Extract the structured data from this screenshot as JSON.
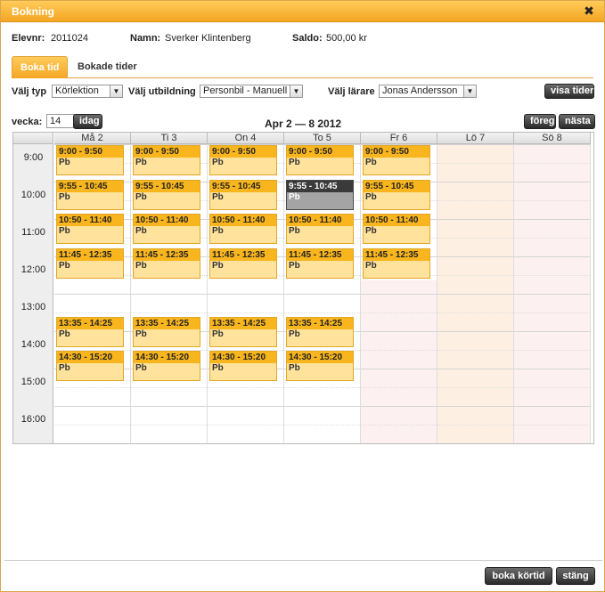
{
  "window": {
    "title": "Bokning"
  },
  "info": {
    "elevnr_label": "Elevnr:",
    "elevnr_value": "2011024",
    "namn_label": "Namn:",
    "namn_value": "Sverker Klintenberg",
    "saldo_label": "Saldo:",
    "saldo_value": "500,00 kr"
  },
  "tabs": [
    {
      "label": "Boka tid",
      "active": true
    },
    {
      "label": "Bokade tider",
      "active": false
    }
  ],
  "filters": {
    "typ_label": "Välj typ",
    "typ_value": "Körlektion",
    "utb_label": "Välj utbildning",
    "utb_value": "Personbil - Manuell",
    "larare_label": "Välj lärare",
    "larare_value": "Jonas Andersson",
    "show_button": "visa tider"
  },
  "week": {
    "label": "vecka:",
    "value": "14",
    "today_button": "idag",
    "range": "Apr 2 — 8 2012",
    "prev_button": "föreg",
    "next_button": "nästa"
  },
  "days": [
    "Må 2",
    "Ti 3",
    "On 4",
    "To 5",
    "Fr 6",
    "Lö 7",
    "Sö 8"
  ],
  "hours": [
    "9:00",
    "10:00",
    "11:00",
    "12:00",
    "13:00",
    "14:00",
    "15:00",
    "16:00"
  ],
  "slot_times": [
    "9:00 - 9:50",
    "9:55 - 10:45",
    "10:50 - 11:40",
    "11:45 - 12:35",
    "13:35 - 14:25",
    "14:30 - 15:20"
  ],
  "slot_code": "Pb",
  "selected_slot": {
    "day": "To 5",
    "time": "9:55 - 10:45"
  },
  "footer": {
    "book_button": "boka körtid",
    "close_button": "stäng"
  },
  "colors": {
    "accent": "#f5a623",
    "slot": "#ffe29b",
    "slot_header": "#f8b51d",
    "selected": "#3a3a3a"
  }
}
